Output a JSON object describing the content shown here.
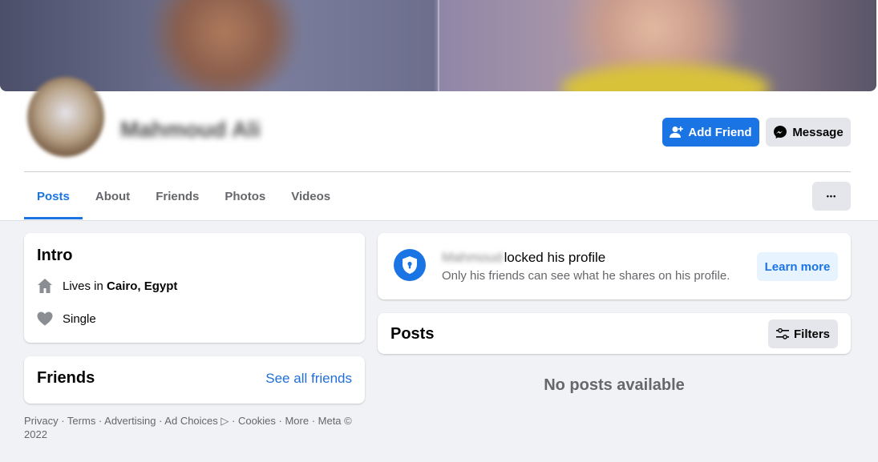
{
  "profile": {
    "name": "Mahmoud Ali"
  },
  "actions": {
    "add_friend": "Add Friend",
    "message": "Message",
    "more": "•••"
  },
  "tabs": [
    {
      "label": "Posts"
    },
    {
      "label": "About"
    },
    {
      "label": "Friends"
    },
    {
      "label": "Photos"
    },
    {
      "label": "Videos"
    }
  ],
  "intro": {
    "title": "Intro",
    "lives_prefix": "Lives in ",
    "lives_city": "Cairo, Egypt",
    "relationship": "Single"
  },
  "friends": {
    "title": "Friends",
    "see_all": "See all friends"
  },
  "footer": {
    "text": "Privacy · Terms · Advertising · Ad Choices ▷ · Cookies · More · Meta © 2022"
  },
  "locked": {
    "name": "Mahmoud",
    "title_suffix": "locked his profile",
    "subtitle": "Only his friends can see what he shares on his profile.",
    "learn_more": "Learn more"
  },
  "posts": {
    "title": "Posts",
    "filters": "Filters",
    "empty": "No posts available"
  },
  "colors": {
    "accent": "#1b74e4",
    "background": "#f0f2f5"
  }
}
